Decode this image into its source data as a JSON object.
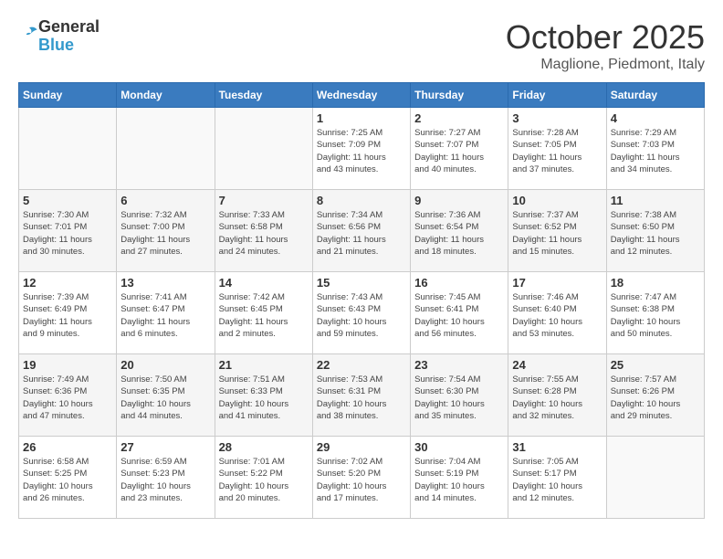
{
  "logo": {
    "general": "General",
    "blue": "Blue"
  },
  "header": {
    "month": "October 2025",
    "location": "Maglione, Piedmont, Italy"
  },
  "weekdays": [
    "Sunday",
    "Monday",
    "Tuesday",
    "Wednesday",
    "Thursday",
    "Friday",
    "Saturday"
  ],
  "weeks": [
    [
      {
        "day": "",
        "info": ""
      },
      {
        "day": "",
        "info": ""
      },
      {
        "day": "",
        "info": ""
      },
      {
        "day": "1",
        "info": "Sunrise: 7:25 AM\nSunset: 7:09 PM\nDaylight: 11 hours\nand 43 minutes."
      },
      {
        "day": "2",
        "info": "Sunrise: 7:27 AM\nSunset: 7:07 PM\nDaylight: 11 hours\nand 40 minutes."
      },
      {
        "day": "3",
        "info": "Sunrise: 7:28 AM\nSunset: 7:05 PM\nDaylight: 11 hours\nand 37 minutes."
      },
      {
        "day": "4",
        "info": "Sunrise: 7:29 AM\nSunset: 7:03 PM\nDaylight: 11 hours\nand 34 minutes."
      }
    ],
    [
      {
        "day": "5",
        "info": "Sunrise: 7:30 AM\nSunset: 7:01 PM\nDaylight: 11 hours\nand 30 minutes."
      },
      {
        "day": "6",
        "info": "Sunrise: 7:32 AM\nSunset: 7:00 PM\nDaylight: 11 hours\nand 27 minutes."
      },
      {
        "day": "7",
        "info": "Sunrise: 7:33 AM\nSunset: 6:58 PM\nDaylight: 11 hours\nand 24 minutes."
      },
      {
        "day": "8",
        "info": "Sunrise: 7:34 AM\nSunset: 6:56 PM\nDaylight: 11 hours\nand 21 minutes."
      },
      {
        "day": "9",
        "info": "Sunrise: 7:36 AM\nSunset: 6:54 PM\nDaylight: 11 hours\nand 18 minutes."
      },
      {
        "day": "10",
        "info": "Sunrise: 7:37 AM\nSunset: 6:52 PM\nDaylight: 11 hours\nand 15 minutes."
      },
      {
        "day": "11",
        "info": "Sunrise: 7:38 AM\nSunset: 6:50 PM\nDaylight: 11 hours\nand 12 minutes."
      }
    ],
    [
      {
        "day": "12",
        "info": "Sunrise: 7:39 AM\nSunset: 6:49 PM\nDaylight: 11 hours\nand 9 minutes."
      },
      {
        "day": "13",
        "info": "Sunrise: 7:41 AM\nSunset: 6:47 PM\nDaylight: 11 hours\nand 6 minutes."
      },
      {
        "day": "14",
        "info": "Sunrise: 7:42 AM\nSunset: 6:45 PM\nDaylight: 11 hours\nand 2 minutes."
      },
      {
        "day": "15",
        "info": "Sunrise: 7:43 AM\nSunset: 6:43 PM\nDaylight: 10 hours\nand 59 minutes."
      },
      {
        "day": "16",
        "info": "Sunrise: 7:45 AM\nSunset: 6:41 PM\nDaylight: 10 hours\nand 56 minutes."
      },
      {
        "day": "17",
        "info": "Sunrise: 7:46 AM\nSunset: 6:40 PM\nDaylight: 10 hours\nand 53 minutes."
      },
      {
        "day": "18",
        "info": "Sunrise: 7:47 AM\nSunset: 6:38 PM\nDaylight: 10 hours\nand 50 minutes."
      }
    ],
    [
      {
        "day": "19",
        "info": "Sunrise: 7:49 AM\nSunset: 6:36 PM\nDaylight: 10 hours\nand 47 minutes."
      },
      {
        "day": "20",
        "info": "Sunrise: 7:50 AM\nSunset: 6:35 PM\nDaylight: 10 hours\nand 44 minutes."
      },
      {
        "day": "21",
        "info": "Sunrise: 7:51 AM\nSunset: 6:33 PM\nDaylight: 10 hours\nand 41 minutes."
      },
      {
        "day": "22",
        "info": "Sunrise: 7:53 AM\nSunset: 6:31 PM\nDaylight: 10 hours\nand 38 minutes."
      },
      {
        "day": "23",
        "info": "Sunrise: 7:54 AM\nSunset: 6:30 PM\nDaylight: 10 hours\nand 35 minutes."
      },
      {
        "day": "24",
        "info": "Sunrise: 7:55 AM\nSunset: 6:28 PM\nDaylight: 10 hours\nand 32 minutes."
      },
      {
        "day": "25",
        "info": "Sunrise: 7:57 AM\nSunset: 6:26 PM\nDaylight: 10 hours\nand 29 minutes."
      }
    ],
    [
      {
        "day": "26",
        "info": "Sunrise: 6:58 AM\nSunset: 5:25 PM\nDaylight: 10 hours\nand 26 minutes."
      },
      {
        "day": "27",
        "info": "Sunrise: 6:59 AM\nSunset: 5:23 PM\nDaylight: 10 hours\nand 23 minutes."
      },
      {
        "day": "28",
        "info": "Sunrise: 7:01 AM\nSunset: 5:22 PM\nDaylight: 10 hours\nand 20 minutes."
      },
      {
        "day": "29",
        "info": "Sunrise: 7:02 AM\nSunset: 5:20 PM\nDaylight: 10 hours\nand 17 minutes."
      },
      {
        "day": "30",
        "info": "Sunrise: 7:04 AM\nSunset: 5:19 PM\nDaylight: 10 hours\nand 14 minutes."
      },
      {
        "day": "31",
        "info": "Sunrise: 7:05 AM\nSunset: 5:17 PM\nDaylight: 10 hours\nand 12 minutes."
      },
      {
        "day": "",
        "info": ""
      }
    ]
  ]
}
